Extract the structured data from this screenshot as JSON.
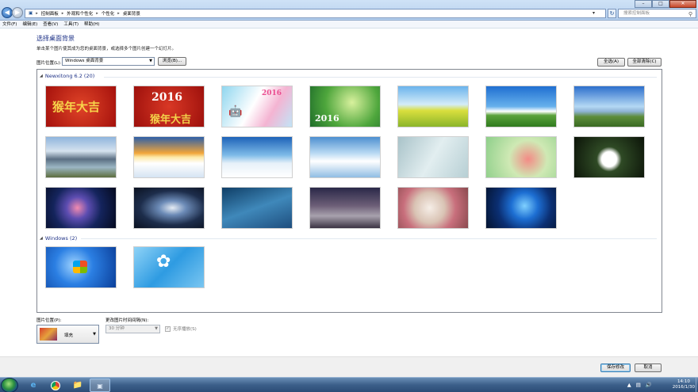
{
  "window": {
    "address_crumbs": [
      "控制面板",
      "外观和个性化",
      "个性化",
      "桌面背景"
    ],
    "search_placeholder": "搜索控制面板",
    "controls": [
      "–",
      "□",
      "✕"
    ]
  },
  "menu": [
    "文件(F)",
    "编辑(E)",
    "查看(V)",
    "工具(T)",
    "帮助(H)"
  ],
  "page": {
    "heading": "选择桌面背景",
    "subtext": "单击某个图片使其成为您的桌面背景，或选择多个图片创建一个幻灯片。",
    "location_label": "图片位置(L):",
    "location_value": "Windows 桌面背景",
    "browse_label": "浏览(B)...",
    "select_all_label": "全选(A)",
    "clear_all_label": "全部清除(C)"
  },
  "groups": [
    {
      "title": "Newxitong 6.2 (20)"
    },
    {
      "title": "Windows (2)"
    }
  ],
  "thumb_text": {
    "t1": "猴年大吉",
    "t2a": "2016",
    "t2b": "猴年大吉",
    "t3": "2016",
    "t4": "2016"
  },
  "options": {
    "position_label": "图片位置(P):",
    "position_value": "填充",
    "interval_label": "更改图片时间间隔(N):",
    "interval_value": "30 分钟",
    "shuffle_label": "无序播放(S)"
  },
  "footer": {
    "save_label": "保存修改",
    "cancel_label": "取消"
  },
  "taskbar": {
    "time": "14:10",
    "date": "2016/1/30"
  }
}
